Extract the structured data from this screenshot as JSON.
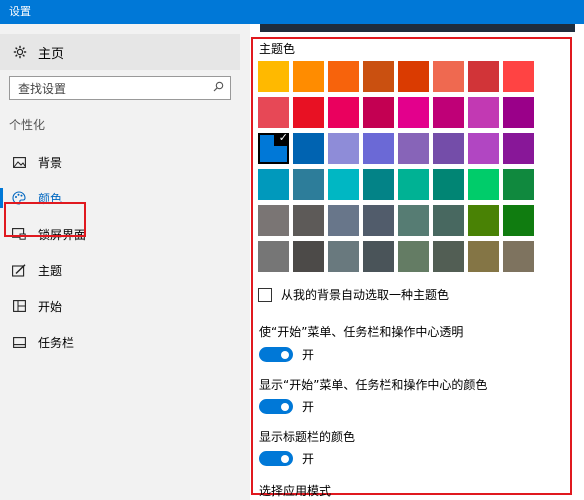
{
  "window": {
    "title": "设置"
  },
  "sidebar": {
    "home": {
      "label": "主页",
      "icon": "gear-icon"
    },
    "search": {
      "placeholder": "查找设置",
      "icon": "search-icon"
    },
    "section_title": "个性化",
    "items": [
      {
        "label": "背景",
        "icon": "picture-icon",
        "active": false
      },
      {
        "label": "颜色",
        "icon": "palette-icon",
        "active": true
      },
      {
        "label": "锁屏界面",
        "icon": "lock-screen-icon",
        "active": false
      },
      {
        "label": "主题",
        "icon": "theme-brush-icon",
        "active": false
      },
      {
        "label": "开始",
        "icon": "start-grid-icon",
        "active": false
      },
      {
        "label": "任务栏",
        "icon": "taskbar-icon",
        "active": false
      }
    ]
  },
  "main": {
    "theme_color_label": "主题色",
    "palette": [
      [
        "#ffb900",
        "#ff8c00",
        "#f7630c",
        "#ca5010",
        "#da3b01",
        "#ef6950",
        "#d13438",
        "#ff4343"
      ],
      [
        "#e74856",
        "#e81123",
        "#ea005e",
        "#c30052",
        "#e3008c",
        "#bf0077",
        "#c239b3",
        "#9a0089"
      ],
      [
        "#0078d7",
        "#0063b1",
        "#8e8cd8",
        "#6b69d6",
        "#8764b8",
        "#744da9",
        "#b146c2",
        "#881798"
      ],
      [
        "#0099bc",
        "#2d7d9a",
        "#00b7c3",
        "#038387",
        "#00b294",
        "#018574",
        "#00cc6a",
        "#10893e"
      ],
      [
        "#7a7574",
        "#5d5a58",
        "#68768a",
        "#515c6b",
        "#567c73",
        "#486860",
        "#498205",
        "#107c10"
      ],
      [
        "#767676",
        "#4c4a48",
        "#69797e",
        "#4a5459",
        "#647c64",
        "#525e54",
        "#847545",
        "#7e735f"
      ]
    ],
    "selected": {
      "row": 2,
      "col": 0
    },
    "auto_pick_label": "从我的背景自动选取一种主题色",
    "auto_pick_checked": false,
    "transparency": {
      "label": "使“开始”菜单、任务栏和操作中心透明",
      "state": "开",
      "on": true
    },
    "show_color_start": {
      "label": "显示“开始”菜单、任务栏和操作中心的颜色",
      "state": "开",
      "on": true
    },
    "show_color_titlebar": {
      "label": "显示标题栏的颜色",
      "state": "开",
      "on": true
    },
    "app_mode_label": "选择应用模式",
    "accent_color": "#0078d7",
    "highlight_color": "#e0191f"
  }
}
